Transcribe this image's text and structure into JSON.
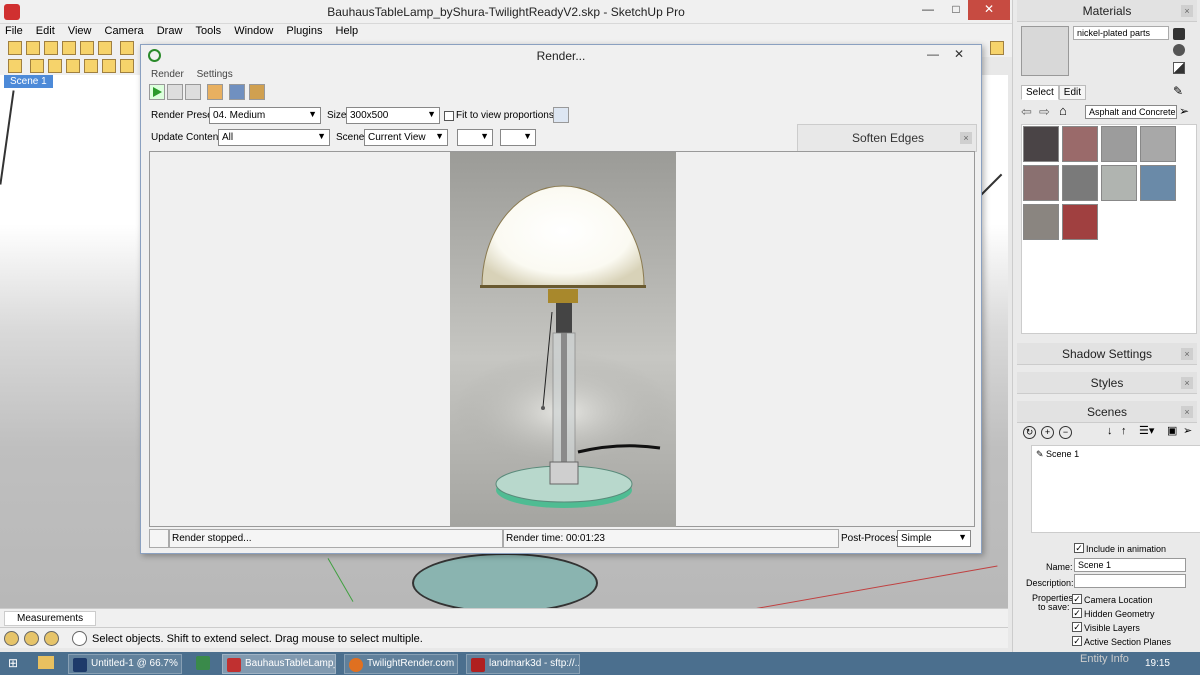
{
  "window": {
    "title": "BauhausTableLamp_byShura-TwilightReadyV2.skp - SketchUp Pro"
  },
  "menu": [
    "File",
    "Edit",
    "View",
    "Camera",
    "Draw",
    "Tools",
    "Window",
    "Plugins",
    "Help"
  ],
  "viewport": {
    "scene_tab": "Scene 1"
  },
  "measurements": {
    "label": "Measurements"
  },
  "status": {
    "hint": "Select objects. Shift to extend select. Drag mouse to select multiple."
  },
  "render_dialog": {
    "title": "Render...",
    "menu": [
      "Render",
      "Settings"
    ],
    "preset_label": "Render Preset:",
    "preset_value": "04. Medium",
    "size_label": "Size:",
    "size_value": "300x500",
    "fit_label": "Fit to view proportions",
    "update_label": "Update Content:",
    "update_value": "All",
    "scene_label": "Scene:",
    "scene_value": "Current View",
    "soften_edges": "Soften Edges",
    "status_text": "Render stopped...",
    "render_time": "Render time: 00:01:23",
    "postprocess_label": "Post-Process:",
    "postprocess_value": "Simple"
  },
  "materials": {
    "header": "Materials",
    "name": "nickel-plated parts",
    "tab_select": "Select",
    "tab_edit": "Edit",
    "library": "Asphalt and Concrete",
    "swatch_colors": [
      "#4a4446",
      "#9a6a6a",
      "#9c9c9c",
      "#a8a8a8",
      "#8a7070",
      "#7a7a7a",
      "#b0b4b0",
      "#6a8aa8",
      "#8a8580",
      "#a04040"
    ]
  },
  "shadow_settings": {
    "header": "Shadow Settings"
  },
  "styles": {
    "header": "Styles"
  },
  "scenes": {
    "header": "Scenes",
    "items": [
      "Scene 1"
    ],
    "include_animation": "Include in animation",
    "name_label": "Name:",
    "name_value": "Scene 1",
    "description_label": "Description:",
    "properties_label_1": "Properties",
    "properties_label_2": "to save:",
    "props": [
      "Camera Location",
      "Hidden Geometry",
      "Visible Layers",
      "Active Section Planes"
    ]
  },
  "taskbar": {
    "items": [
      "Untitled-1 @ 66.7% (...",
      "BauhausTableLamp_...",
      "TwilightRender.com ...",
      "landmark3d - sftp://..."
    ],
    "overlay_text": "Entity Info",
    "clock": "19:15"
  }
}
